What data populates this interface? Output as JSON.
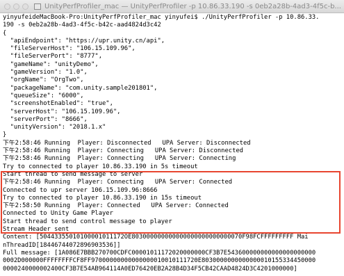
{
  "window": {
    "title": "UnityPerfProfiler_mac — UnityPerfProfiler -p 10.86.33.190 -s 0eb2a28b-4ad3-4f5c-b..."
  },
  "highlight": {
    "color": "#e8452f"
  },
  "terminal": {
    "lines": [
      "yinyufeideMacBook-Pro:UnityPerfProfiler_mac yinyufei$ ./UnityPerfProfiler -p 10.86.33.",
      "190 -s 0eb2a28b-4ad3-4f5c-b42c-aad4824d3c42",
      "{",
      "  \"apiEndpoint\": \"https://upr.unity.cn/api\",",
      "  \"fileServerHost\": \"106.15.109.96\",",
      "  \"fileServerPort\": \"8777\",",
      "  \"gameName\": \"unityDemo\",",
      "  \"gameVersion\": \"1.0\",",
      "  \"orgName\": \"OrgTwo\",",
      "  \"packageName\": \"com.unity.sample201801\",",
      "  \"queueSize\": \"6000\",",
      "  \"screenshotEnabled\": \"true\",",
      "  \"serverHost\": \"106.15.109.96\",",
      "  \"serverPort\": \"8666\",",
      "  \"unityVersion\": \"2018.1.x\"",
      "}",
      "下午2:58:46 Running  Player: Disconnected   UPA Server: Disconnected",
      "下午2:58:46 Running  Player: Connecting   UPA Server: Disconnected",
      "下午2:58:46 Running  Player: Connecting   UPA Server: Connecting",
      "Try to connected to player 10.86.33.190 in 5s timeout",
      "Start thread to send message to server",
      "下午2:58:46 Running  Player: Connecting   UPA Server: Connected",
      "Connected to upr server 106.15.109.96:8666",
      "Try to connected to player 10.86.33.190 in 15s timeout",
      "下午2:58:50 Running  Player: Connected   UPA Server: Connected",
      "Connected to Unity Game Player",
      "Start thread to send control message to player",
      "Stream Header sent",
      "Content: [50443355010100001011172OE803000000000000000000000000070F98FCFFFFFFFFF Mai",
      "nThreadID[18446744072896903536]]",
      "Full message: [1A086E7BBB270700CDFC00001011172020000000CF3B7E543600000000000000000000",
      "0002D000000FFFFFFFFCF8FF97000000000000000010010111720E8030000000000000010155334450000",
      "0000240000002400CF3B7E54AB964114A0ED76420EB2A28B4D34F5CB42CAAD4824D3C4201000000]"
    ]
  }
}
